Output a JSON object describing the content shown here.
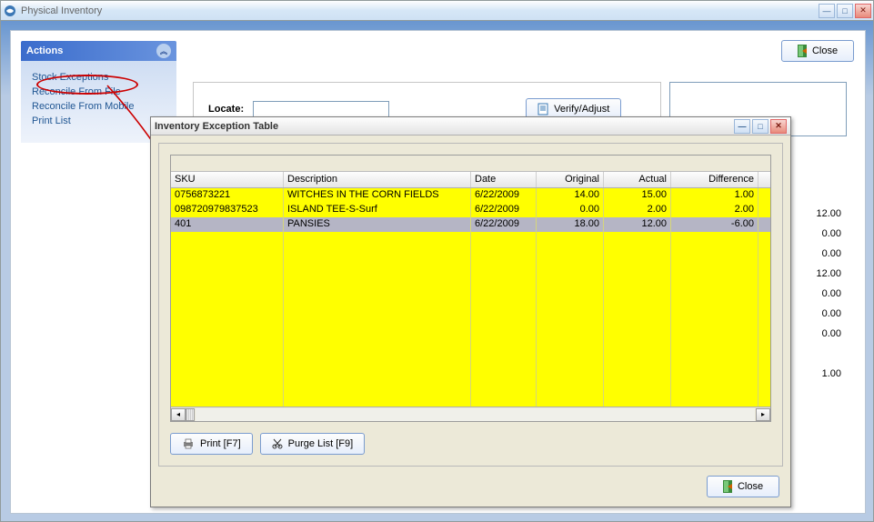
{
  "outer": {
    "title": "Physical Inventory",
    "close_label": "Close"
  },
  "sidebar": {
    "title": "Actions",
    "items": [
      "Stock Exceptions",
      "Reconcile From File",
      "Reconcile From Mobile",
      "Print List"
    ]
  },
  "locate": {
    "label": "Locate:",
    "value": "",
    "verify_label": "Verify/Adjust"
  },
  "right_numbers": [
    "12.00",
    "0.00",
    "0.00",
    "12.00",
    "0.00",
    "0.00",
    "0.00",
    "",
    "1.00"
  ],
  "dialog": {
    "title": "Inventory Exception Table",
    "columns": [
      "SKU",
      "Description",
      "Date",
      "Original",
      "Actual",
      "Difference"
    ],
    "rows": [
      {
        "sku": "0756873221",
        "desc": "WITCHES IN THE CORN FIELDS",
        "date": "6/22/2009",
        "orig": "14.00",
        "act": "15.00",
        "diff": "1.00",
        "sel": false
      },
      {
        "sku": "098720979837523",
        "desc": "ISLAND TEE-S-Surf",
        "date": "6/22/2009",
        "orig": "0.00",
        "act": "2.00",
        "diff": "2.00",
        "sel": false
      },
      {
        "sku": "401",
        "desc": "PANSIES",
        "date": "6/22/2009",
        "orig": "18.00",
        "act": "12.00",
        "diff": "-6.00",
        "sel": true
      }
    ],
    "print_label": "Print [F7]",
    "purge_label": "Purge List [F9]",
    "close_label": "Close"
  }
}
